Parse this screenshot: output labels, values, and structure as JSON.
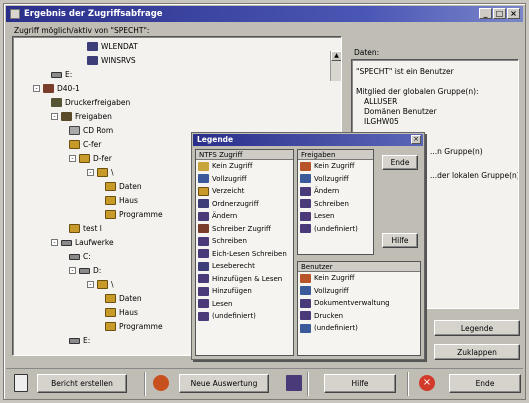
{
  "window": {
    "title": "Ergebnis der Zugriffsabfrage"
  },
  "left": {
    "label": "Zugriff möglich/aktiv von \"SPECHT\":",
    "tree": [
      {
        "text": "WLENDAT",
        "icon": "computer-icon",
        "depth": 3
      },
      {
        "text": "WINSRVS",
        "icon": "computer-icon",
        "depth": 3
      },
      {
        "text": "E:",
        "icon": "drive-icon",
        "depth": 1
      },
      {
        "text": "D40-1",
        "icon": "server-icon",
        "depth": 0,
        "exp": "-"
      },
      {
        "text": "Druckerfreigaben",
        "icon": "printer-icon",
        "depth": 1
      },
      {
        "text": "Freigaben",
        "icon": "share-icon",
        "depth": 1,
        "exp": "-"
      },
      {
        "text": "CD Rom",
        "icon": "disk-icon",
        "depth": 2
      },
      {
        "text": "C-fer",
        "icon": "folder-icon",
        "depth": 2
      },
      {
        "text": "D-fer",
        "icon": "folder-icon",
        "depth": 2,
        "exp": "-"
      },
      {
        "text": "\\",
        "icon": "folder-icon",
        "depth": 3,
        "exp": "-"
      },
      {
        "text": "Daten",
        "icon": "folder-icon",
        "depth": 4
      },
      {
        "text": "Haus",
        "icon": "folder-icon",
        "depth": 4
      },
      {
        "text": "Programme",
        "icon": "folder-icon",
        "depth": 4
      },
      {
        "text": "test l",
        "icon": "folder-icon",
        "depth": 2
      },
      {
        "text": "Laufwerke",
        "icon": "drive-icon",
        "depth": 1,
        "exp": "-"
      },
      {
        "text": "C:",
        "icon": "drive-icon",
        "depth": 2
      },
      {
        "text": "D:",
        "icon": "drive-icon",
        "depth": 2,
        "exp": "-"
      },
      {
        "text": "\\",
        "icon": "folder-icon",
        "depth": 3,
        "exp": "-"
      },
      {
        "text": "Daten",
        "icon": "folder-icon",
        "depth": 4
      },
      {
        "text": "Haus",
        "icon": "folder-icon",
        "depth": 4
      },
      {
        "text": "Programme",
        "icon": "folder-icon",
        "depth": 4
      },
      {
        "text": "E:",
        "icon": "drive-icon",
        "depth": 2
      }
    ]
  },
  "right": {
    "label": "Daten:",
    "lines": [
      "\"SPECHT\" ist ein Benutzer",
      "",
      "Mitglied der globalen Gruppe(n):",
      "ALLUSER",
      "Domänen Benutzer",
      "ILGHW05"
    ],
    "lines2": [
      "...n Gruppe(n)",
      "",
      "...der lokalen Gruppe(n)"
    ],
    "legend_button": "Legende",
    "close_button": "Zuklappen"
  },
  "legend": {
    "title": "Legende",
    "ntfs_header": "NTFS Zugriff",
    "ntfs_items": [
      "Kein Zugriff",
      "Vollzugriff",
      "Verzeicht",
      "Ordnerzugriff",
      "Ändern",
      "Schreiber Zugriff",
      "Schreiben",
      "Eich-Lesen Schreiben",
      "Leseberecht",
      "Hinzufügen & Lesen",
      "Hinzufügen",
      "Lesen",
      "(undefiniert)"
    ],
    "share_header": "Freigaben",
    "share_items": [
      "Kein Zugriff",
      "Vollzugriff",
      "Ändern",
      "Schreiben",
      "Lesen",
      "(undefiniert)"
    ],
    "user_header": "Benutzer",
    "user_items": [
      "Kein Zugriff",
      "Vollzugriff",
      "Dokumentverwaltung",
      "Drucken",
      "(undefiniert)"
    ],
    "ende_button": "Ende",
    "hilfe_button": "Hilfe"
  },
  "toolbar": {
    "report_button": "Bericht erstellen",
    "new_button": "Neue Auswertung",
    "help_button": "Hilfe",
    "end_button": "Ende"
  }
}
